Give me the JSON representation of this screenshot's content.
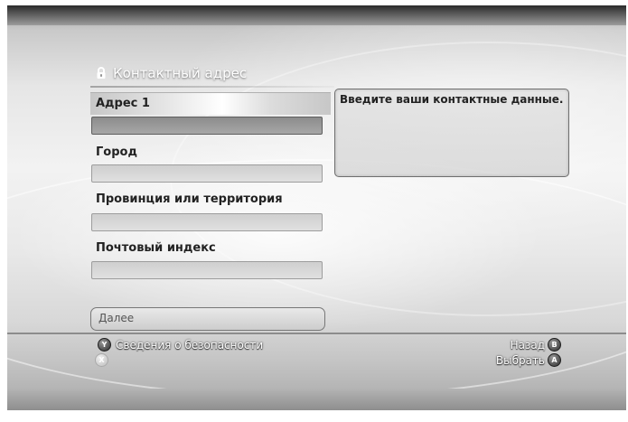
{
  "screen": {
    "title": "Контактный адрес",
    "title_icon": "lock-icon"
  },
  "form": {
    "fields": [
      {
        "label": "Адрес 1",
        "value": ""
      },
      {
        "label": "Город",
        "value": ""
      },
      {
        "label": "Провинция или территория",
        "value": ""
      },
      {
        "label": "Почтовый индекс",
        "value": ""
      }
    ],
    "next_button": "Далее"
  },
  "info": {
    "text": "Введите ваши контактные данные."
  },
  "footer": {
    "y_hint": {
      "glyph": "Y",
      "label": "Сведения о безопасности"
    },
    "x_hint": {
      "glyph": "X"
    },
    "b_hint": {
      "glyph": "B",
      "label": "Назад"
    },
    "a_hint": {
      "glyph": "A",
      "label": "Выбрать"
    }
  }
}
